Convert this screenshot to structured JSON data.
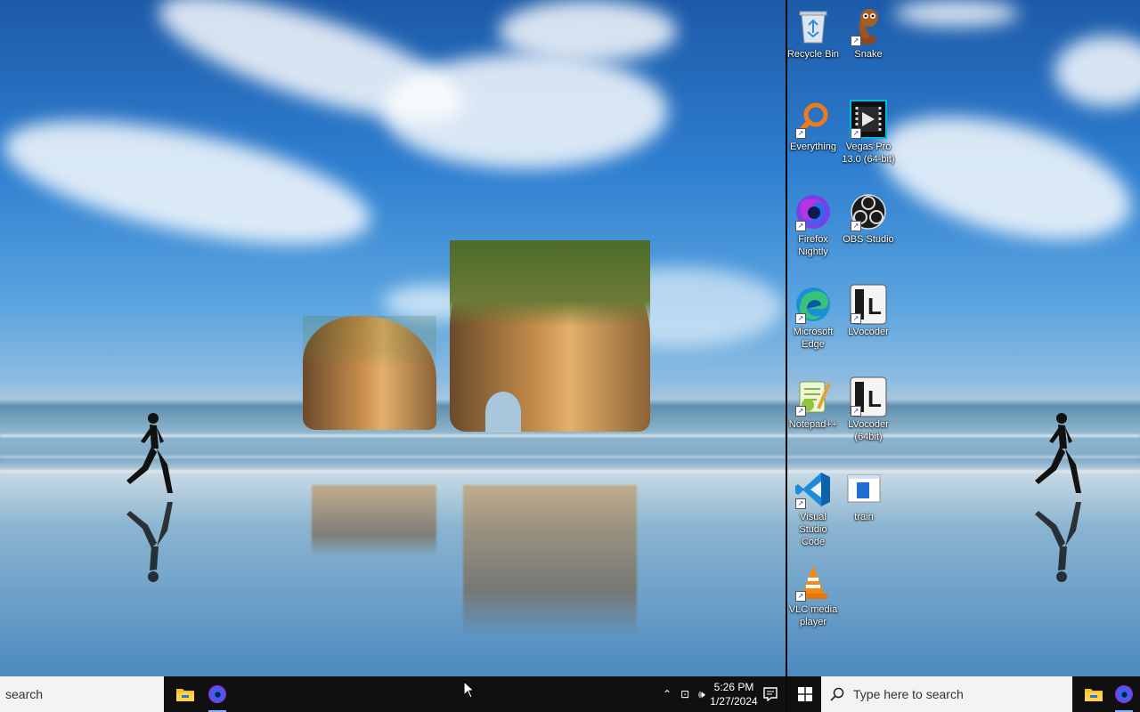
{
  "desktop": {
    "icons": [
      {
        "label": "Recycle Bin",
        "icon": "recycle-bin-icon"
      },
      {
        "label": "Snake",
        "icon": "snake-icon"
      },
      {
        "label": "Everything",
        "icon": "everything-search-icon"
      },
      {
        "label": "Vegas Pro 13.0 (64-bit)",
        "icon": "vegas-pro-icon"
      },
      {
        "label": "Firefox Nightly",
        "icon": "firefox-nightly-icon"
      },
      {
        "label": "OBS Studio",
        "icon": "obs-studio-icon"
      },
      {
        "label": "Microsoft Edge",
        "icon": "edge-icon"
      },
      {
        "label": "LVocoder",
        "icon": "lvocoder-icon"
      },
      {
        "label": "Notepad++",
        "icon": "notepad-plus-plus-icon"
      },
      {
        "label": "LVocoder (64bit)",
        "icon": "lvocoder-64-icon"
      },
      {
        "label": "Visual Studio Code",
        "icon": "vscode-icon"
      },
      {
        "label": "train",
        "icon": "train-file-icon"
      },
      {
        "label": "VLC media player",
        "icon": "vlc-icon"
      }
    ]
  },
  "taskbar_left": {
    "search_placeholder": "search",
    "pinned": [
      {
        "name": "File Explorer",
        "icon": "file-explorer-icon"
      },
      {
        "name": "Firefox Nightly",
        "icon": "firefox-nightly-icon"
      }
    ],
    "tray": {
      "time": "5:26 PM",
      "date": "1/27/2024"
    }
  },
  "taskbar_right": {
    "search_placeholder": "Type here to search",
    "pinned": [
      {
        "name": "File Explorer",
        "icon": "file-explorer-icon"
      },
      {
        "name": "Firefox Nightly",
        "icon": "firefox-nightly-icon"
      }
    ]
  },
  "colors": {
    "taskbar": "#101010",
    "search_box": "#f3f3f3",
    "accent": "#7fb6ff"
  }
}
